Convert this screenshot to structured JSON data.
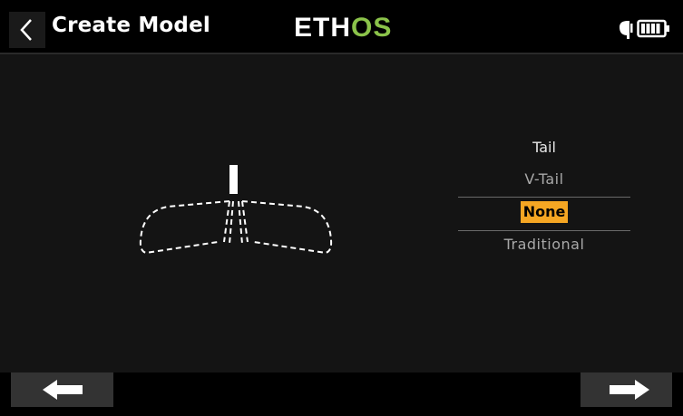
{
  "header": {
    "title": "Create Model",
    "logo_part1": "ETH",
    "logo_part2": "OS",
    "back_icon": "chevron-left-icon",
    "status_icons": [
      "antenna-icon",
      "battery-icon"
    ]
  },
  "selector": {
    "heading": "Tail",
    "options": [
      "V-Tail",
      "None",
      "Traditional"
    ],
    "selected": "None"
  },
  "diagram": {
    "icon": "tail-none-diagram-icon"
  },
  "footer": {
    "prev_icon": "arrow-left-icon",
    "next_icon": "arrow-right-icon"
  },
  "colors": {
    "accent": "#f5a623",
    "logo_green": "#8bc34a",
    "background": "#141414",
    "header": "#000000"
  }
}
